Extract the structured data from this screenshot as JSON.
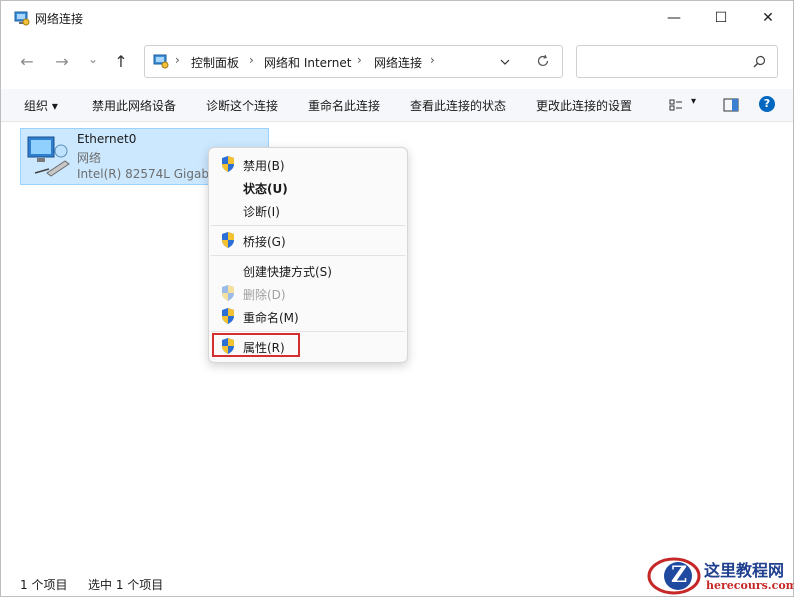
{
  "window": {
    "title": "网络连接"
  },
  "controls": {
    "minimize": "—",
    "maximize": "☐",
    "close": "✕"
  },
  "nav": {
    "back": "←",
    "forward": "→",
    "recent": "⌄",
    "up": "↑"
  },
  "breadcrumb": [
    "控制面板",
    "网络和 Internet",
    "网络连接"
  ],
  "address_sep": "›",
  "search": {
    "placeholder": ""
  },
  "toolbar": {
    "organize": "组织 ▾",
    "disable": "禁用此网络设备",
    "diagnose": "诊断这个连接",
    "rename": "重命名此连接",
    "status": "查看此连接的状态",
    "change": "更改此连接的设置",
    "view": "▾",
    "help": "?"
  },
  "connection": {
    "name": "Ethernet0",
    "type": "网络",
    "adapter": "Intel(R) 82574L Gigabit"
  },
  "context_menu": {
    "disable": "禁用(B)",
    "status": "状态(U)",
    "diagnose": "诊断(I)",
    "bridge": "桥接(G)",
    "shortcut": "创建快捷方式(S)",
    "delete": "删除(D)",
    "rename": "重命名(M)",
    "properties": "属性(R)"
  },
  "statusbar": {
    "count": "1 个项目",
    "selected": "选中 1 个项目"
  },
  "watermark": {
    "text": "这里教程网",
    "url": "herecours.com",
    "letter": "Z"
  },
  "colors": {
    "accent": "#0067c0",
    "selection": "#cce8ff",
    "highlight": "#d32f2f"
  }
}
